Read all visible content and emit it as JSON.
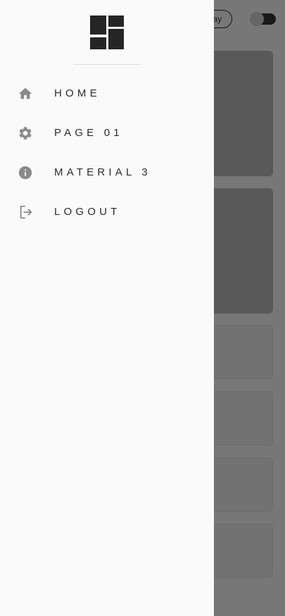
{
  "background": {
    "chip_label": "ay",
    "switch_on": false
  },
  "drawer": {
    "logo_icon": "dashboard-logo-icon",
    "items": [
      {
        "label": "HOME",
        "icon": "home-icon"
      },
      {
        "label": "PAGE 01",
        "icon": "gear-icon"
      },
      {
        "label": "MATERIAL 3",
        "icon": "info-icon"
      },
      {
        "label": "LOGOUT",
        "icon": "logout-icon"
      }
    ]
  },
  "colors": {
    "drawer_bg": "#fafafa",
    "icon": "#8a8a8a",
    "label": "#2b2b2b",
    "logo": "#252525"
  }
}
